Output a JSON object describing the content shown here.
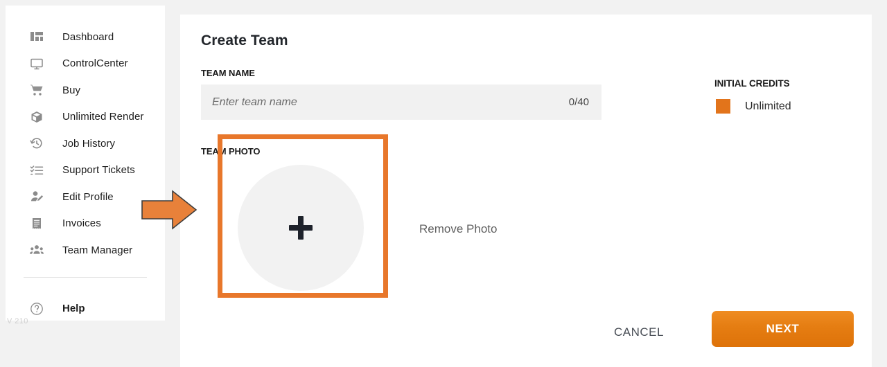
{
  "sidebar": {
    "items": [
      {
        "label": "Dashboard",
        "icon": "dashboard-grid-icon"
      },
      {
        "label": "ControlCenter",
        "icon": "monitor-icon"
      },
      {
        "label": "Buy",
        "icon": "shopping-cart-icon"
      },
      {
        "label": "Unlimited Render",
        "icon": "box-icon"
      },
      {
        "label": "Job History",
        "icon": "history-clock-icon"
      },
      {
        "label": "Support Tickets",
        "icon": "checklist-icon"
      },
      {
        "label": "Edit Profile",
        "icon": "user-edit-icon"
      },
      {
        "label": "Invoices",
        "icon": "invoice-icon"
      },
      {
        "label": "Team Manager",
        "icon": "users-group-icon"
      }
    ],
    "help": {
      "label": "Help",
      "icon": "question-circle-icon"
    },
    "version": "V 210"
  },
  "main": {
    "title": "Create Team",
    "team_name": {
      "label": "TEAM NAME",
      "placeholder": "Enter team name",
      "value": "",
      "counter": "0/40"
    },
    "team_photo": {
      "label": "TEAM PHOTO",
      "add_icon": "plus-icon",
      "remove_label": "Remove Photo"
    },
    "credits": {
      "label": "INITIAL CREDITS",
      "value": "Unlimited",
      "swatch_color": "#e2741b"
    },
    "actions": {
      "cancel_label": "CANCEL",
      "next_label": "NEXT"
    }
  },
  "annotations": {
    "highlight_color": "#e8772b",
    "arrow_color": "#e8813a"
  }
}
